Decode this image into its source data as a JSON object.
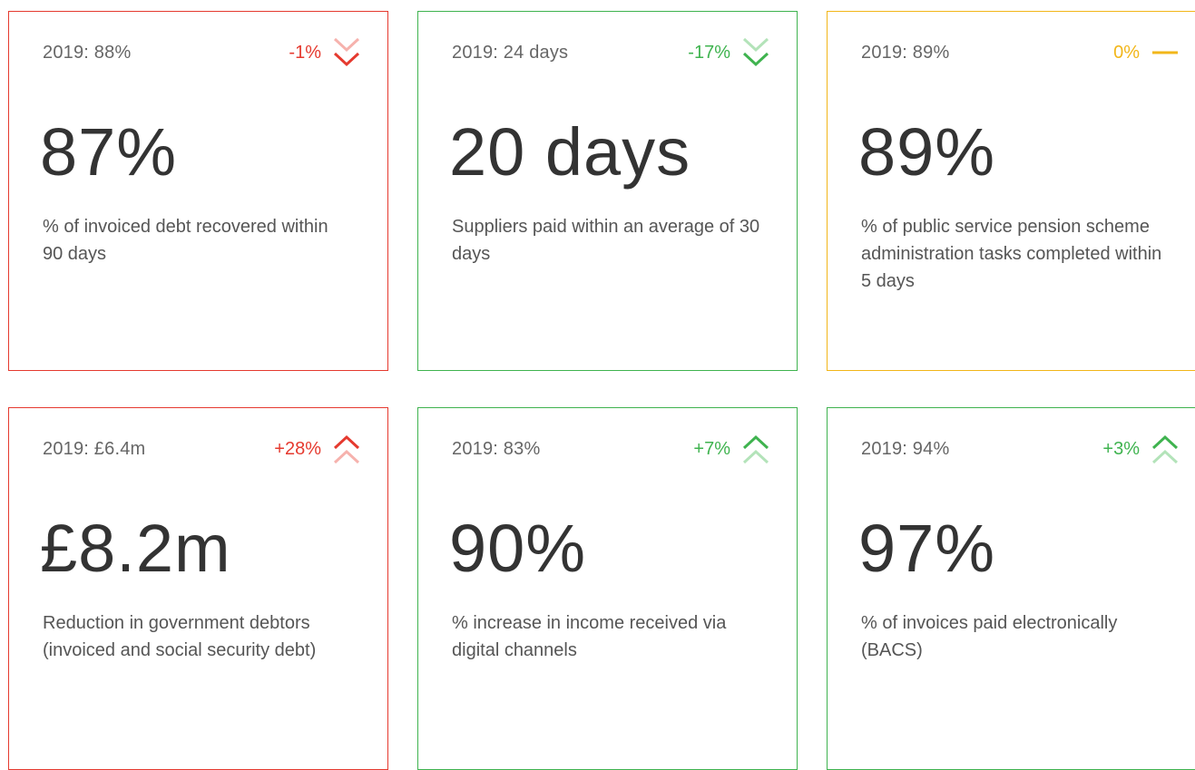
{
  "cards": [
    {
      "previous": "2019: 88%",
      "change": "-1%",
      "trend": "down",
      "status": "red",
      "value": "87%",
      "description": "% of invoiced debt recovered within 90 days"
    },
    {
      "previous": "2019: 24 days",
      "change": "-17%",
      "trend": "down",
      "status": "green",
      "value": "20 days",
      "description": "Suppliers paid within an average of 30 days"
    },
    {
      "previous": "2019: 89%",
      "change": "0%",
      "trend": "flat",
      "status": "amber",
      "value": "89%",
      "description": "% of public service pension scheme administration tasks completed within 5 days"
    },
    {
      "previous": "2019: £6.4m",
      "change": "+28%",
      "trend": "up",
      "status": "red",
      "value": "£8.2m",
      "description": "Reduction in government debtors (invoiced and social security debt)"
    },
    {
      "previous": "2019: 83%",
      "change": "+7%",
      "trend": "up",
      "status": "green",
      "value": "90%",
      "description": "% increase in income received via digital channels"
    },
    {
      "previous": "2019: 94%",
      "change": "+3%",
      "trend": "up",
      "status": "green",
      "value": "97%",
      "description": "% of invoices paid electronically (BACS)"
    }
  ],
  "colors": {
    "red": "#e53a2f",
    "green": "#3fb34f",
    "amber": "#f2b619",
    "red_light": "#f6b2ad",
    "green_light": "#b3e3b9"
  }
}
